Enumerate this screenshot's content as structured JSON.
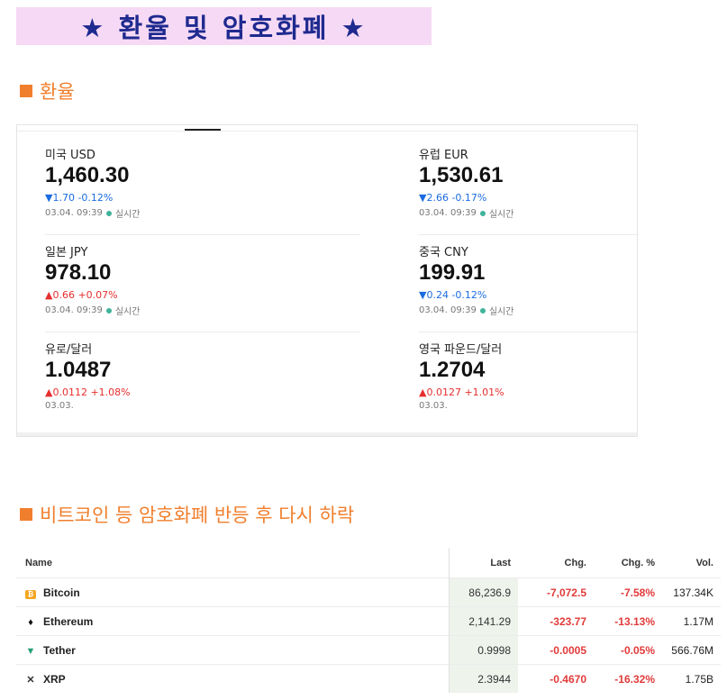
{
  "banner": {
    "title": "★ 환율 및 암호화폐 ★"
  },
  "section1": {
    "heading": "환율"
  },
  "fx": [
    {
      "name": "미국 USD",
      "price": "1,460.30",
      "dir": "down",
      "change": "▼1.70  -0.12%",
      "date": "03.04. 09:39",
      "live": "실시간"
    },
    {
      "name": "유럽 EUR",
      "price": "1,530.61",
      "dir": "down",
      "change": "▼2.66  -0.17%",
      "date": "03.04. 09:39",
      "live": "실시간"
    },
    {
      "name": "일본 JPY",
      "price": "978.10",
      "dir": "up",
      "change": "▲0.66  +0.07%",
      "date": "03.04. 09:39",
      "live": "실시간"
    },
    {
      "name": "중국 CNY",
      "price": "199.91",
      "dir": "down",
      "change": "▼0.24  -0.12%",
      "date": "03.04. 09:39",
      "live": "실시간"
    },
    {
      "name": "유로/달러",
      "price": "1.0487",
      "dir": "up",
      "change": "▲0.0112  +1.08%",
      "date": "03.03.",
      "live": ""
    },
    {
      "name": "영국 파운드/달러",
      "price": "1.2704",
      "dir": "up",
      "change": "▲0.0127  +1.01%",
      "date": "03.03.",
      "live": ""
    }
  ],
  "section2": {
    "heading": "비트코인 등 암호화폐 반등 후 다시 하락"
  },
  "crypto": {
    "headers": {
      "name": "Name",
      "last": "Last",
      "chg": "Chg.",
      "chg_pct": "Chg. %",
      "vol": "Vol."
    },
    "rows": [
      {
        "icon": "bitcoin-icon",
        "name": "Bitcoin",
        "last": "86,236.9",
        "chg": "-7,072.5",
        "chg_pct": "-7.58%",
        "vol": "137.34K"
      },
      {
        "icon": "ethereum-icon",
        "name": "Ethereum",
        "last": "2,141.29",
        "chg": "-323.77",
        "chg_pct": "-13.13%",
        "vol": "1.17M"
      },
      {
        "icon": "tether-icon",
        "name": "Tether",
        "last": "0.9998",
        "chg": "-0.0005",
        "chg_pct": "-0.05%",
        "vol": "566.76M"
      },
      {
        "icon": "xrp-icon",
        "name": "XRP",
        "last": "2.3944",
        "chg": "-0.4670",
        "chg_pct": "-16.32%",
        "vol": "1.75B"
      }
    ]
  },
  "colors": {
    "accent": "#f07f2d",
    "banner_bg": "#f6d9f5",
    "banner_text": "#1f2a8f",
    "down": "#1b6ce0",
    "up": "#e62e2e",
    "live_dot": "#3fb39b"
  }
}
